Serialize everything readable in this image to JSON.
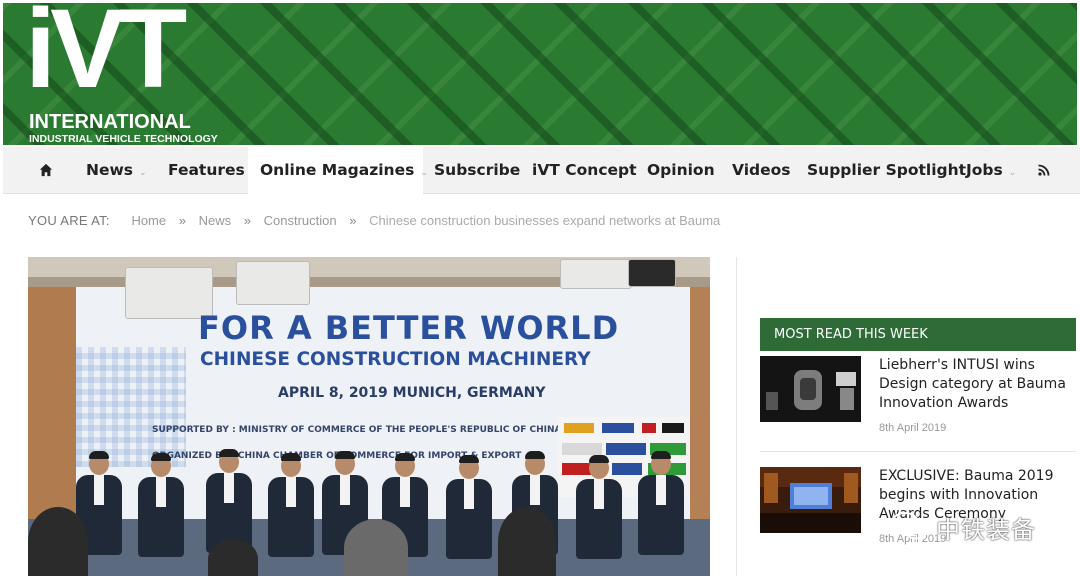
{
  "site": {
    "logo_big": "iVT",
    "logo_line1": "INTERNATIONAL",
    "logo_line2": "INDUSTRIAL VEHICLE TECHNOLOGY"
  },
  "nav": {
    "home_icon": "home-icon",
    "items": [
      {
        "label": "News",
        "has_dropdown": true
      },
      {
        "label": "Features",
        "has_dropdown": false
      },
      {
        "label": "Online Magazines",
        "has_dropdown": true,
        "active": true
      },
      {
        "label": "Subscribe",
        "has_dropdown": false
      },
      {
        "label": "iVT Concept",
        "has_dropdown": false
      },
      {
        "label": "Opinion",
        "has_dropdown": false
      },
      {
        "label": "Videos",
        "has_dropdown": false
      },
      {
        "label": "Supplier Spotlight",
        "has_dropdown": false
      },
      {
        "label": "Jobs",
        "has_dropdown": true
      }
    ],
    "rss_icon": "rss-icon",
    "dropdown_icon": "chevron-down-icon"
  },
  "breadcrumb": {
    "label": "YOU ARE AT:",
    "items": [
      "Home",
      "News",
      "Construction"
    ],
    "separator": "»",
    "current": "Chinese construction businesses expand networks at Bauma"
  },
  "hero": {
    "banner_line1": "FOR A BETTER WORLD",
    "banner_line2": "CHINESE CONSTRUCTION MACHINERY",
    "banner_line3": "APRIL 8, 2019    MUNICH, GERMANY",
    "banner_line4": "SUPPORTED BY :   MINISTRY OF COMMERCE OF THE PEOPLE'S REPUBLIC OF CHINA",
    "banner_line5": "ORGANIZED BY :   CHINA CHAMBER OF COMMERCE FOR IMPORT & EXPORT"
  },
  "sidebar": {
    "heading": "MOST READ THIS WEEK",
    "articles": [
      {
        "title": "Liebherr's INTUSI wins Design category at Bauma Innovation Awards",
        "date": "8th April 2019"
      },
      {
        "title": "EXCLUSIVE: Bauma 2019 begins with Innovation Awards Ceremony",
        "date": "8th April 2019"
      }
    ]
  },
  "watermark": {
    "text": "中铁装备",
    "icon": "wechat-icon"
  },
  "colors": {
    "header_green": "#2e7d34",
    "sidebar_heading_bg": "#2e6b36",
    "nav_bg": "#f2f2f2",
    "banner_blue": "#2a4f9c"
  }
}
